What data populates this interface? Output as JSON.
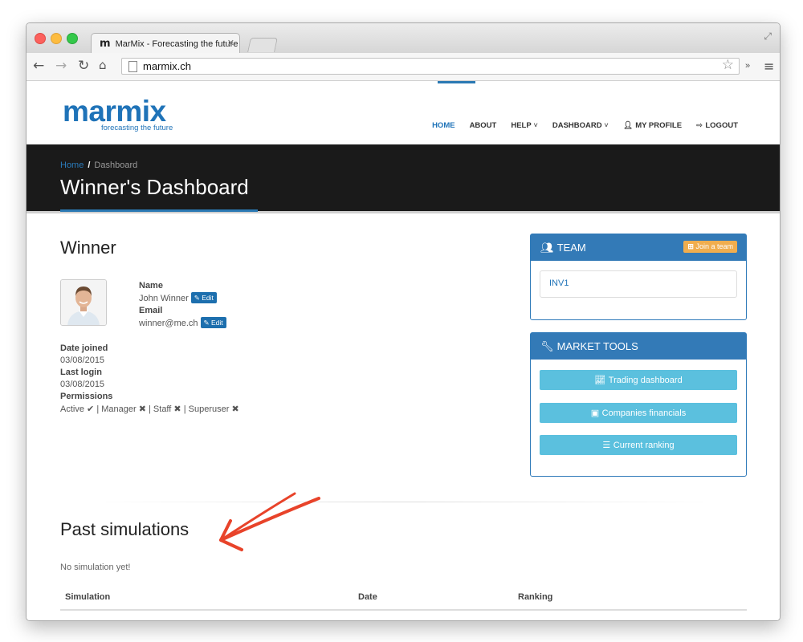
{
  "browser": {
    "tab_title": "MarMix - Forecasting the future",
    "tab_favicon": "m",
    "url": "marmix.ch"
  },
  "site": {
    "logo_text": "marmix",
    "logo_tagline": "forecasting the future",
    "brand_color": "#1f73b8",
    "nav": {
      "home": "HOME",
      "about": "ABOUT",
      "help": "HELP",
      "dashboard": "DASHBOARD",
      "my_profile": "MY PROFILE",
      "logout": "LOGOUT"
    }
  },
  "hero": {
    "breadcrumb_home": "Home",
    "breadcrumb_sep": "/",
    "breadcrumb_current": "Dashboard",
    "title": "Winner's Dashboard"
  },
  "user": {
    "title": "Winner",
    "name_label": "Name",
    "name_value": "John Winner",
    "email_label": "Email",
    "email_value": "winner@me.ch",
    "edit_label": "Edit",
    "date_joined_label": "Date joined",
    "date_joined_value": "03/08/2015",
    "last_login_label": "Last login",
    "last_login_value": "03/08/2015",
    "permissions_label": "Permissions",
    "permissions": {
      "active": "Active",
      "manager": "Manager",
      "staff": "Staff",
      "superuser": "Superuser",
      "sep": "|"
    }
  },
  "team_panel": {
    "title": "TEAM",
    "join_label": "Join a team",
    "team_name": "INV1"
  },
  "market_tools": {
    "title": "MARKET TOOLS",
    "buttons": {
      "trading": "Trading dashboard",
      "financials": "Companies financials",
      "ranking": "Current ranking"
    }
  },
  "past_simulations": {
    "title": "Past simulations",
    "empty_message": "No simulation yet!",
    "columns": {
      "simulation": "Simulation",
      "date": "Date",
      "ranking": "Ranking"
    }
  },
  "colors": {
    "panel_blue": "#337ab7",
    "info_button": "#5bc0de",
    "warning_button": "#f0ad4e",
    "annotation_arrow": "#e8432a"
  }
}
